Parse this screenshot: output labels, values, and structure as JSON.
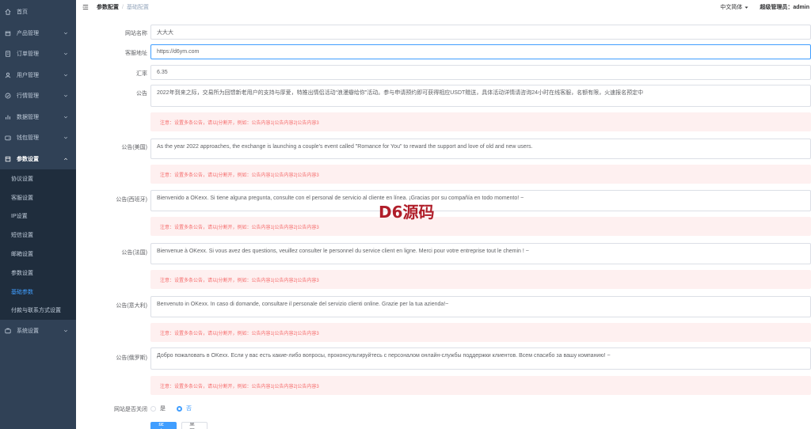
{
  "sidebar": {
    "items": [
      {
        "label": "首页",
        "icon": "home-icon"
      },
      {
        "label": "产品管理",
        "icon": "box-icon"
      },
      {
        "label": "订单管理",
        "icon": "order-icon"
      },
      {
        "label": "用户管理",
        "icon": "user-icon"
      },
      {
        "label": "行情管理",
        "icon": "market-icon"
      },
      {
        "label": "数据管理",
        "icon": "data-icon"
      },
      {
        "label": "钱包管理",
        "icon": "wallet-icon"
      },
      {
        "label": "参数设置",
        "icon": "settings-icon"
      }
    ],
    "submenu": [
      {
        "label": "协议设置"
      },
      {
        "label": "客服设置"
      },
      {
        "label": "IP设置"
      },
      {
        "label": "短信设置"
      },
      {
        "label": "邮箱设置"
      },
      {
        "label": "参数设置"
      },
      {
        "label": "基础参数",
        "active": true
      },
      {
        "label": "付款与联系方式设置"
      }
    ],
    "system": {
      "label": "系统设置",
      "icon": "system-icon"
    }
  },
  "header": {
    "breadcrumb": [
      "参数配置",
      "基础配置"
    ],
    "language": "中文简体",
    "admin_label": "超级管理员：admin"
  },
  "form": {
    "site_name": {
      "label": "网站名称",
      "value": "大大大"
    },
    "service_url": {
      "label": "客服地址",
      "value": "https://d6ym.com"
    },
    "rate": {
      "label": "汇率",
      "value": "6.35"
    },
    "notice": {
      "label": "公告",
      "value": "2022年到来之际，交易所为回馈新老用户的支持与厚爱，特推出情侣活动“浪漫瓣给你”活动。参与申请预约即可获得相应USDT赠送，具体活动详情请咨询24小时在线客服，名额有限，火速报名预定中"
    },
    "notice_en": {
      "label": "公告(美国)",
      "value": "As the year 2022 approaches, the exchange is launching a couple's event called \"Romance for You\" to reward the support and love of old and new users."
    },
    "notice_es": {
      "label": "公告(西班牙)",
      "value": "Bienvenido a OKexx. Si tiene alguna pregunta, consulte con el personal de servicio al cliente en línea. ¡Gracias por su compañía en todo momento! ~"
    },
    "notice_fr": {
      "label": "公告(法国)",
      "value": "Bienvenue à OKexx. Si vous avez des questions, veuillez consulter le personnel du service client en ligne. Merci pour votre entreprise tout le chemin ! ~"
    },
    "notice_it": {
      "label": "公告(意大利)",
      "value": "Benvenuto in OKexx. In caso di domande, consultare il personale del servizio clienti online. Grazie per la tua azienda!~"
    },
    "notice_ru": {
      "label": "公告(俄罗斯)",
      "value": "Добро пожаловать в OKexx. Если у вас есть какие-либо вопросы, проконсультируйтесь с персоналом онлайн-службы поддержки клиентов. Всем спасибо за вашу компанию! ~"
    },
    "hint": "注意：设置多条公告，请以|分割开，例如：公告内容1|公告内容2|公告内容3",
    "site_closed": {
      "label": "网站是否关闭",
      "options": [
        "是",
        "否"
      ],
      "selected": "否"
    },
    "buttons": {
      "submit": "提交",
      "reset": "重置"
    }
  },
  "watermark": "D6源码",
  "colors": {
    "sidebar_bg": "#304156",
    "accent": "#409eff",
    "alert_bg": "#fef0f0",
    "alert_text": "#f56c6c"
  }
}
